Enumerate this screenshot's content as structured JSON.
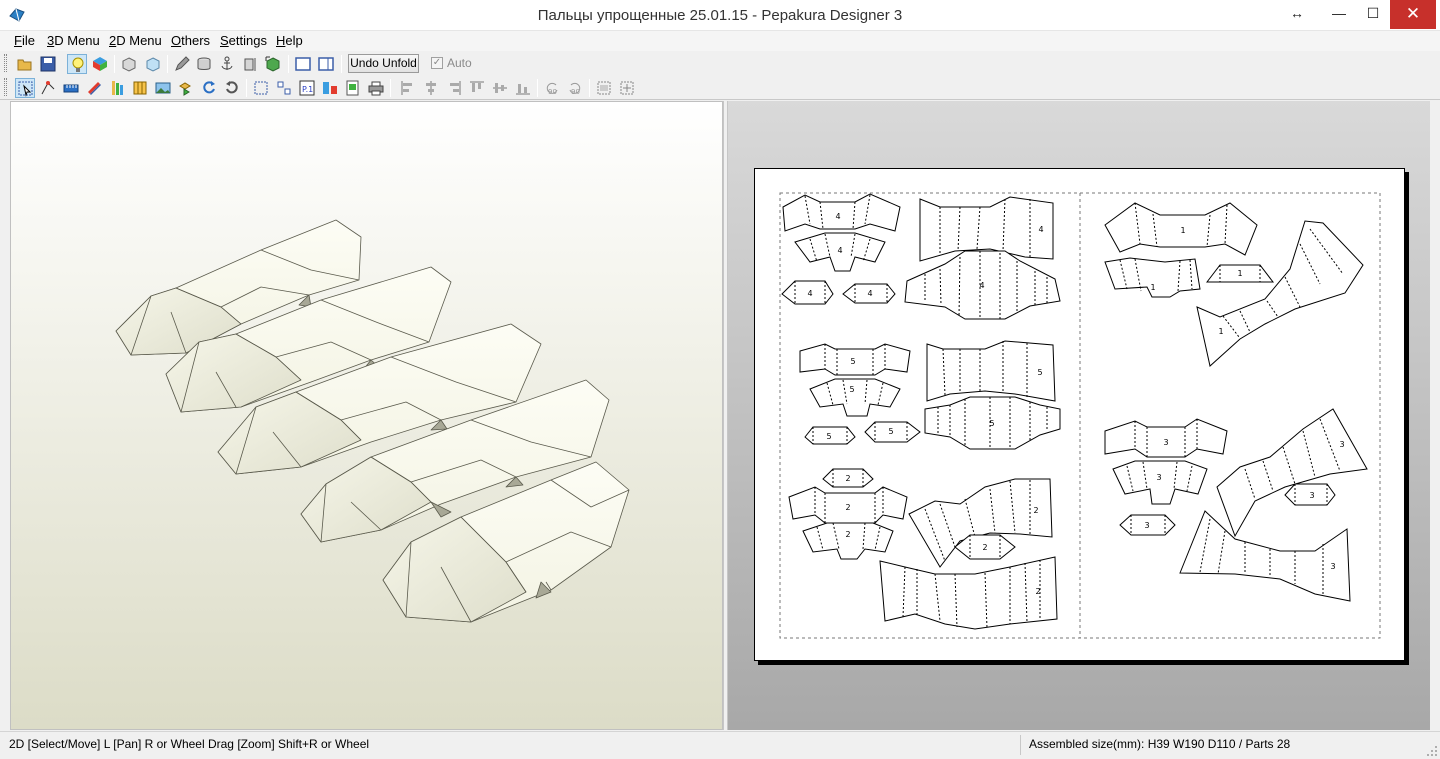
{
  "window": {
    "title": "Пальцы упрощенные 25.01.15 - Pepakura Designer 3",
    "resize_glyph": "↔",
    "minimize_glyph": "—",
    "maximize_glyph": "☐",
    "close_glyph": "✕"
  },
  "menu": [
    "File",
    "3D Menu",
    "2D Menu",
    "Others",
    "Settings",
    "Help"
  ],
  "toolbar1": {
    "icons": [
      "open-folder-icon",
      "save-icon",
      "lightbulb-icon",
      "color-cube-icon",
      "box-icon",
      "texture-box-icon",
      "pencil-icon",
      "cylinder-icon",
      "anchor-icon",
      "dimension-icon",
      "3d-move-icon",
      "single-view-icon",
      "split-view-icon"
    ],
    "undo_label": "Undo Unfold",
    "auto_label": "Auto",
    "auto_checked": true
  },
  "toolbar2": {
    "icons": [
      "select-move-icon",
      "edit-edge-icon",
      "ruler-icon",
      "pencils-icon",
      "rainbow-icon",
      "fold-lines-icon",
      "image-icon",
      "join-parts-icon",
      "rotate-back-icon",
      "rotate-icon",
      "fit-page-icon",
      "fit-parts-icon",
      "page-number-icon",
      "layout-icon",
      "export-icon",
      "print-icon",
      "align-left-icon",
      "align-center-icon",
      "align-right-icon",
      "align-top-icon",
      "align-middle-icon",
      "align-bottom-icon",
      "rotate-90-ccw-icon",
      "rotate-90-cw-icon",
      "flip-h-icon",
      "flip-v-icon"
    ],
    "rotate_left_label": "90",
    "rotate_right_label": "90"
  },
  "status": {
    "mode_text": "2D [Select/Move] L [Pan] R or Wheel Drag [Zoom] Shift+R or Wheel",
    "size_text": "Assembled size(mm): H39 W190 D110 / Parts 28"
  },
  "colors": {
    "model_fill": "#fbfbf0",
    "model_shade": "#e8e8d6",
    "model_edge": "#5a5a4c",
    "close_button": "#c7302b",
    "view_background_top": "#ffffff",
    "view_background_bottom": "#dcdcc7",
    "paper_area": "#a8a8a8"
  },
  "parts": {
    "labels": [
      "4",
      "4",
      "4",
      "4",
      "4",
      "4",
      "1",
      "1",
      "1",
      "1",
      "5",
      "5",
      "5",
      "5",
      "5",
      "5",
      "3",
      "3",
      "3",
      "3",
      "3",
      "3",
      "2",
      "2",
      "2",
      "2",
      "2",
      "2"
    ]
  }
}
